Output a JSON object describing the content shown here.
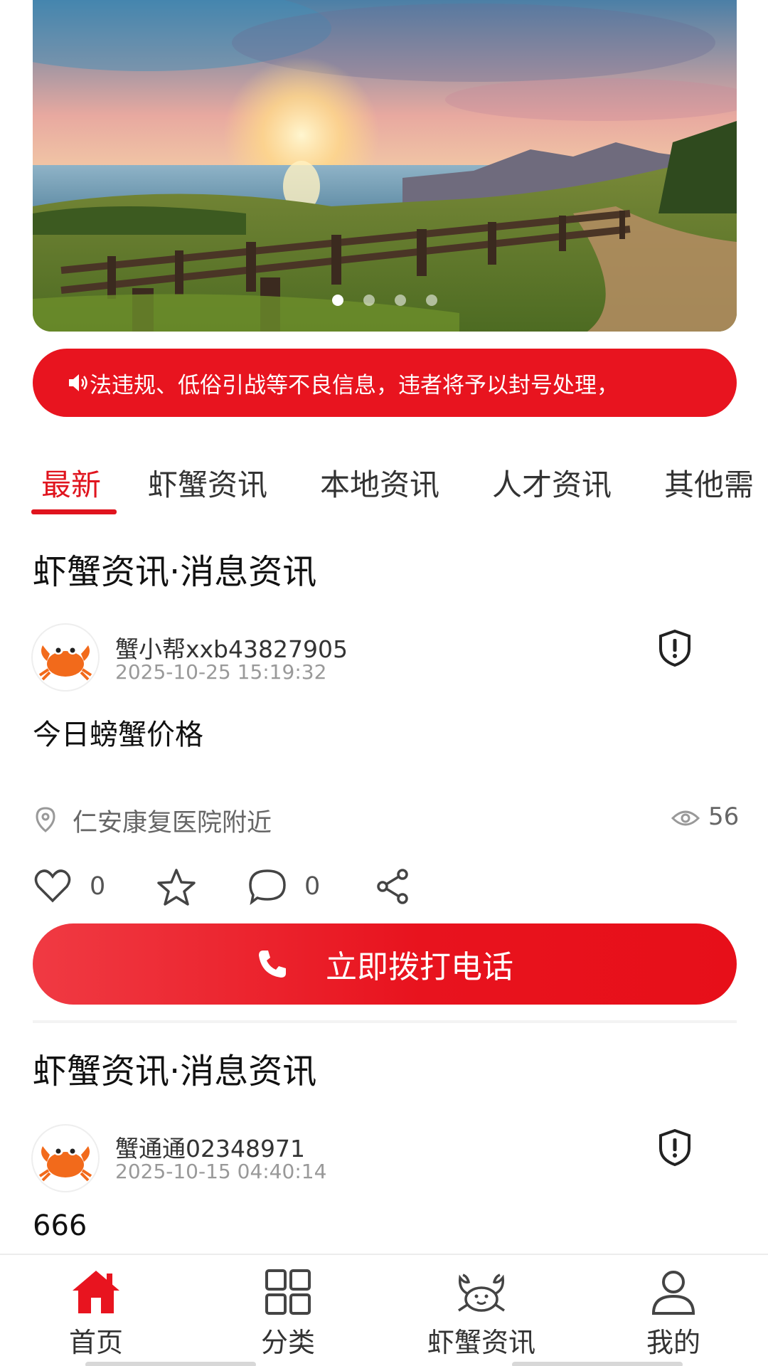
{
  "banner": {
    "dots": 4,
    "active_dot": 0
  },
  "notice": {
    "icon": "speaker-icon",
    "text": "法违规、低俗引战等不良信息，违者将予以封号处理，"
  },
  "tabs": [
    {
      "label": "最新",
      "active": true
    },
    {
      "label": "虾蟹资讯"
    },
    {
      "label": "本地资讯"
    },
    {
      "label": "人才资讯"
    },
    {
      "label": "其他需"
    }
  ],
  "posts": [
    {
      "title": "虾蟹资讯·消息资讯",
      "author": "蟹小帮xxb43827905",
      "time": "2025-10-25 15:19:32",
      "content": "今日螃蟹价格",
      "location": "仁安康复医院附近",
      "views": "56",
      "likes": "0",
      "comments": "0",
      "call_label": "立即拨打电话"
    },
    {
      "title": "虾蟹资讯·消息资讯",
      "author": "蟹通通02348971",
      "time": "2025-10-15 04:40:14",
      "content": "666"
    }
  ],
  "bottom_nav": [
    {
      "label": "首页",
      "icon": "home-icon",
      "active": true
    },
    {
      "label": "分类",
      "icon": "grid-icon"
    },
    {
      "label": "虾蟹资讯",
      "icon": "crab-icon"
    },
    {
      "label": "我的",
      "icon": "user-icon"
    }
  ],
  "colors": {
    "primary": "#e8141f",
    "text": "#111111",
    "muted": "#999999"
  }
}
